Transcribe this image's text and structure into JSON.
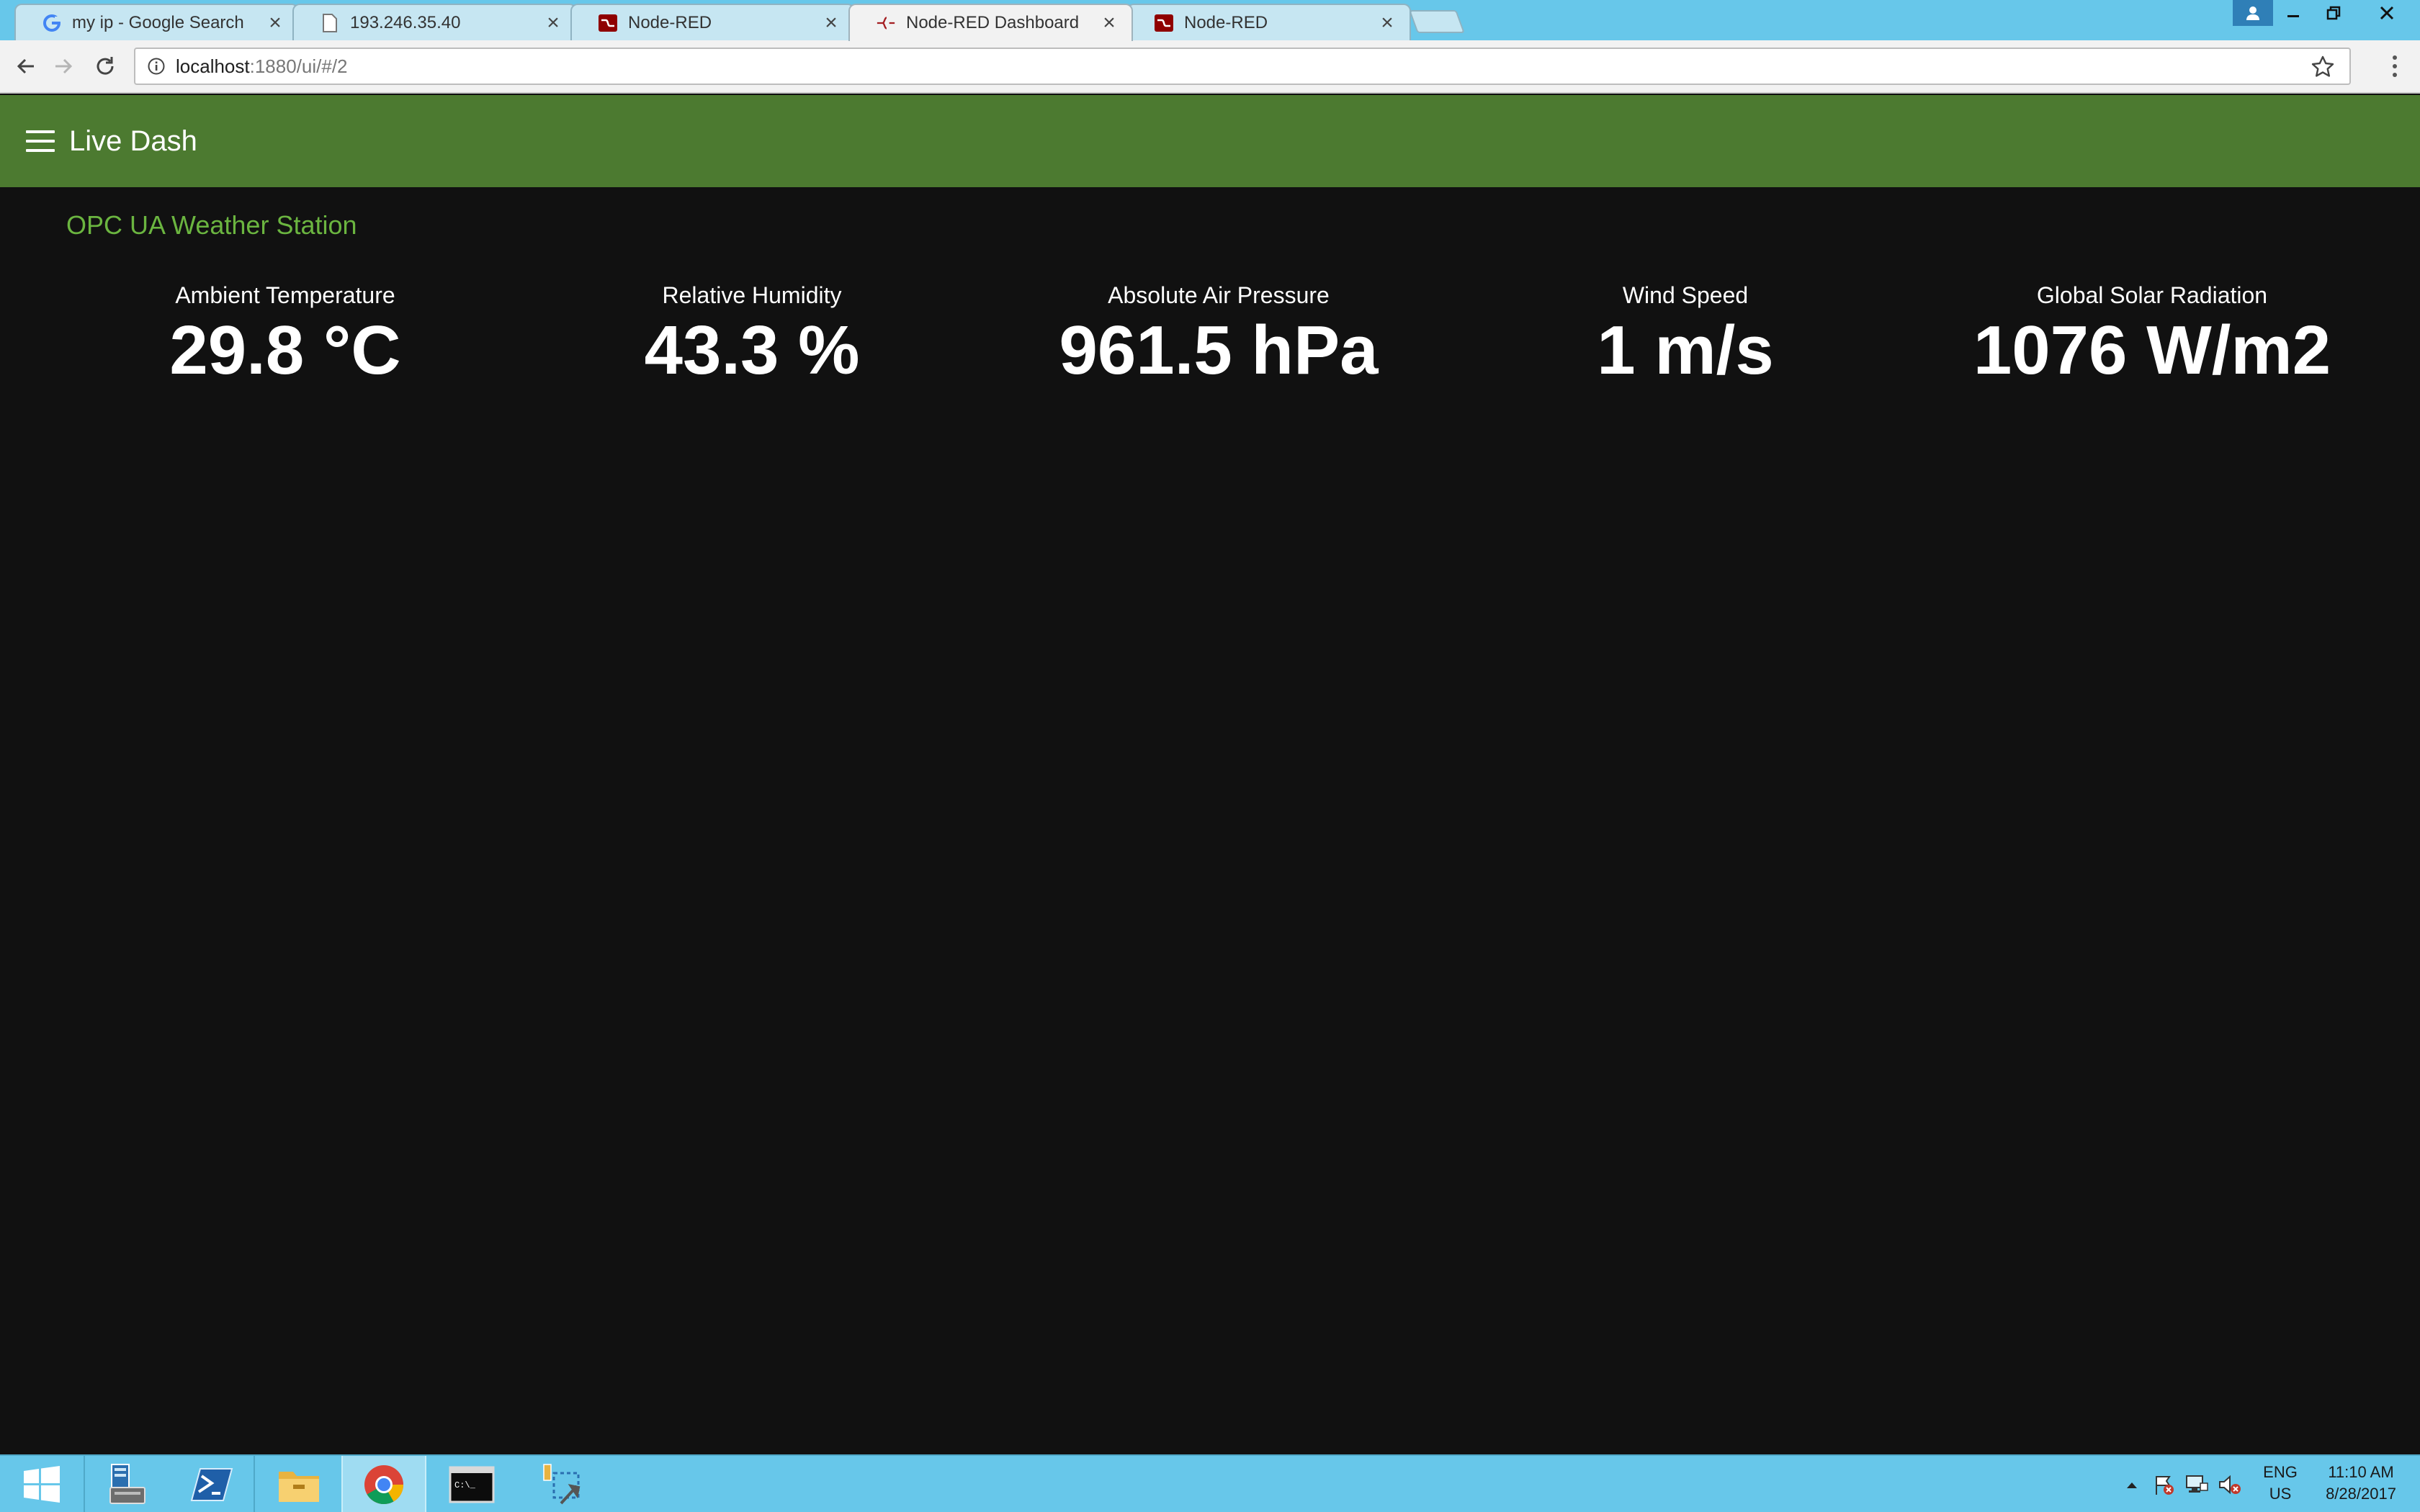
{
  "browser": {
    "tabs": [
      {
        "title": "my ip - Google Search",
        "icon": "google-icon"
      },
      {
        "title": "193.246.35.40",
        "icon": "page-icon"
      },
      {
        "title": "Node-RED",
        "icon": "node-red-icon"
      },
      {
        "title": "Node-RED Dashboard",
        "icon": "node-red-dashboard-icon",
        "active": true
      },
      {
        "title": "Node-RED",
        "icon": "node-red-icon"
      }
    ],
    "address": {
      "host": "localhost",
      "rest": ":1880/ui/#/2"
    }
  },
  "dashboard": {
    "title": "Live Dash",
    "header_color": "#4c7a30",
    "group_title": "OPC UA Weather Station",
    "group_title_color": "#6bb540",
    "widgets": [
      {
        "label": "Ambient Temperature",
        "value": "29.8 °C"
      },
      {
        "label": "Relative Humidity",
        "value": "43.3 %"
      },
      {
        "label": "Absolute Air Pressure",
        "value": "961.5 hPa"
      },
      {
        "label": "Wind Speed",
        "value": "1 m/s"
      },
      {
        "label": "Global Solar Radiation",
        "value": "1076 W/m2"
      }
    ]
  },
  "taskbar": {
    "apps": [
      "start-icon",
      "server-manager-icon",
      "powershell-icon",
      "file-explorer-icon",
      "chrome-icon",
      "cmd-icon",
      "network-tool-icon"
    ],
    "language": {
      "line1": "ENG",
      "line2": "US"
    },
    "clock": {
      "time": "11:10 AM",
      "date": "8/28/2017"
    }
  }
}
